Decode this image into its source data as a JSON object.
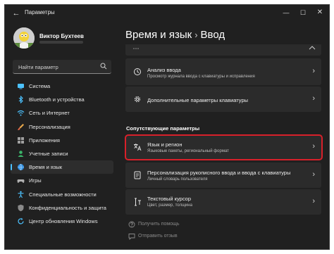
{
  "titlebar": {
    "app_title": "Параметры",
    "back": "←",
    "minimize": "—",
    "maximize": "☐",
    "close": "✕"
  },
  "user": {
    "name": "Виктор Бухтеев"
  },
  "search": {
    "placeholder": "Найти параметр"
  },
  "sidebar": {
    "items": [
      {
        "label": "Система",
        "icon": "monitor-icon",
        "active": false
      },
      {
        "label": "Bluetooth и устройства",
        "icon": "bluetooth-icon",
        "active": false
      },
      {
        "label": "Сеть и Интернет",
        "icon": "wifi-icon",
        "active": false
      },
      {
        "label": "Персонализация",
        "icon": "brush-icon",
        "active": false
      },
      {
        "label": "Приложения",
        "icon": "apps-icon",
        "active": false
      },
      {
        "label": "Учетные записи",
        "icon": "person-icon",
        "active": false
      },
      {
        "label": "Время и язык",
        "icon": "globe-clock-icon",
        "active": true
      },
      {
        "label": "Игры",
        "icon": "gamepad-icon",
        "active": false
      },
      {
        "label": "Специальные возможности",
        "icon": "accessibility-icon",
        "active": false
      },
      {
        "label": "Конфиденциальность и защита",
        "icon": "shield-icon",
        "active": false
      },
      {
        "label": "Центр обновления Windows",
        "icon": "update-icon",
        "active": false
      }
    ]
  },
  "header": {
    "crumb": "Время и язык",
    "separator": "›",
    "current": "Ввод"
  },
  "cards": {
    "input_analysis": {
      "title": "Анализ ввода",
      "desc": "Просмотр журнала ввода с клавиатуры и исправления"
    },
    "advanced_keyboard": {
      "title": "Дополнительные параметры клавиатуры"
    }
  },
  "related": {
    "header": "Сопутствующие параметры",
    "language_region": {
      "title": "Язык и регион",
      "desc": "Языковые пакеты, региональный формат"
    },
    "pen_personalization": {
      "title": "Персонализация рукописного ввода и ввода с клавиатуры",
      "desc": "Личный словарь пользователя"
    },
    "text_cursor": {
      "title": "Текстовый курсор",
      "desc": "Цвет, размер, толщина"
    }
  },
  "footer": {
    "help": "Получить помощь",
    "feedback": "Отправить отзыв"
  },
  "colors": {
    "accent": "#4cc2ff",
    "highlight": "#d8202a",
    "background": "#202020",
    "card": "#2b2b2b"
  }
}
